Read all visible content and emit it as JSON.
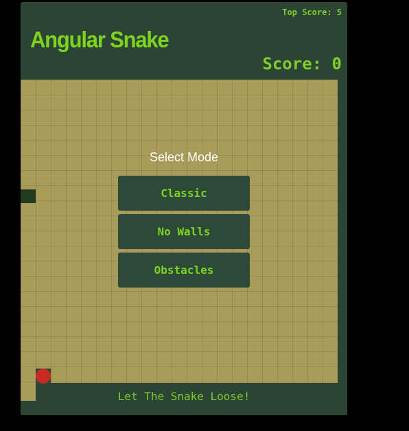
{
  "header": {
    "top_score": "Top Score: 5",
    "title": "Angular Snake",
    "score": "Score: 0"
  },
  "menu": {
    "heading": "Select Mode",
    "modes": [
      "Classic",
      "No Walls",
      "Obstacles"
    ]
  },
  "footer": {
    "message": "Let The Snake Loose!"
  },
  "colors": {
    "frame": "#2c4434",
    "board": "#a99c5b",
    "accent_green": "#7ed321",
    "snake": "#233a1e",
    "food": "#c52b20"
  }
}
